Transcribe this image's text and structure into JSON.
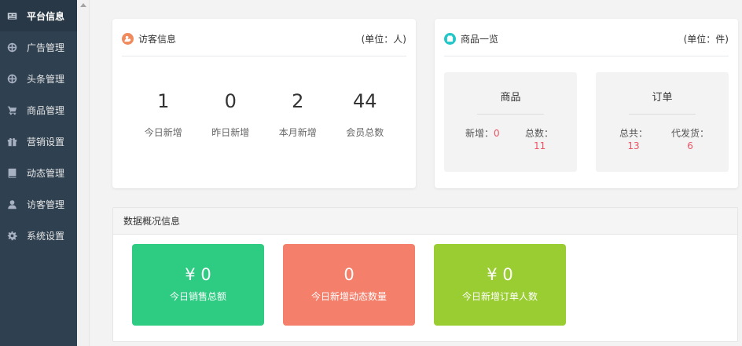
{
  "sidebar": {
    "items": [
      {
        "label": "平台信息",
        "icon": "newspaper-icon",
        "active": true
      },
      {
        "label": "广告管理",
        "icon": "globe-icon"
      },
      {
        "label": "头条管理",
        "icon": "globe-icon"
      },
      {
        "label": "商品管理",
        "icon": "cart-icon"
      },
      {
        "label": "营销设置",
        "icon": "gift-icon"
      },
      {
        "label": "动态管理",
        "icon": "book-icon"
      },
      {
        "label": "访客管理",
        "icon": "user-icon"
      },
      {
        "label": "系统设置",
        "icon": "gear-icon"
      }
    ]
  },
  "visitor": {
    "title": "访客信息",
    "unit": "(单位：人)",
    "accent": "#f08a5d",
    "stats": [
      {
        "value": "1",
        "label": "今日新增"
      },
      {
        "value": "0",
        "label": "昨日新增"
      },
      {
        "value": "2",
        "label": "本月新增"
      },
      {
        "value": "44",
        "label": "会员总数"
      }
    ]
  },
  "goods": {
    "title": "商品一览",
    "unit": "(单位：件)",
    "accent": "#23c6c8",
    "product": {
      "title": "商品",
      "new_label": "新增：",
      "new_value": "0",
      "total_label": "总数：",
      "total_value": "11"
    },
    "order": {
      "title": "订单",
      "total_label": "总共：",
      "total_value": "13",
      "pending_label": "代发货：",
      "pending_value": "6"
    }
  },
  "overview": {
    "title": "数据概况信息",
    "tiles": [
      {
        "value": "¥ 0",
        "label": "今日销售总额",
        "color": "#2ecc82"
      },
      {
        "value": "0",
        "label": "今日新增动态数量",
        "color": "#f47f6b"
      },
      {
        "value": "¥ 0",
        "label": "今日新增订单人数",
        "color": "#9acd32"
      }
    ]
  }
}
